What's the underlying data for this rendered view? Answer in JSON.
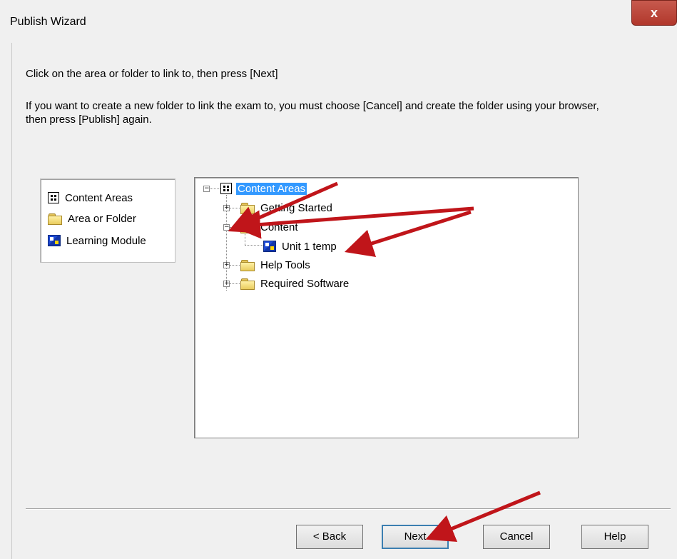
{
  "window": {
    "title": "Publish Wizard",
    "close_label": "x"
  },
  "instructions": {
    "line1": "Click on the area or folder to link to, then press [Next]",
    "line2": "If you want to create a new folder to link the exam to, you must choose [Cancel] and create the folder using your browser, then press [Publish] again."
  },
  "legend": {
    "items": [
      {
        "icon": "content-areas-icon",
        "label": "Content Areas"
      },
      {
        "icon": "folder-icon",
        "label": "Area or Folder"
      },
      {
        "icon": "learning-module-icon",
        "label": "Learning Module"
      }
    ]
  },
  "tree": {
    "root": {
      "label": "Content Areas",
      "expanded": true,
      "selected": true
    },
    "nodes": [
      {
        "label": "Getting Started",
        "expanded": false,
        "icon": "folder-icon"
      },
      {
        "label": "Content",
        "expanded": true,
        "icon": "folder-icon",
        "children": [
          {
            "label": "Unit 1 temp",
            "icon": "learning-module-icon"
          }
        ]
      },
      {
        "label": "Help Tools",
        "expanded": false,
        "icon": "folder-icon"
      },
      {
        "label": "Required Software",
        "expanded": false,
        "icon": "folder-icon"
      }
    ]
  },
  "buttons": {
    "back": "< Back",
    "next": "Next",
    "cancel": "Cancel",
    "help": "Help"
  },
  "colors": {
    "selection": "#3399ff",
    "annotation_arrow": "#c0151a",
    "close_button": "#c75a4e"
  }
}
